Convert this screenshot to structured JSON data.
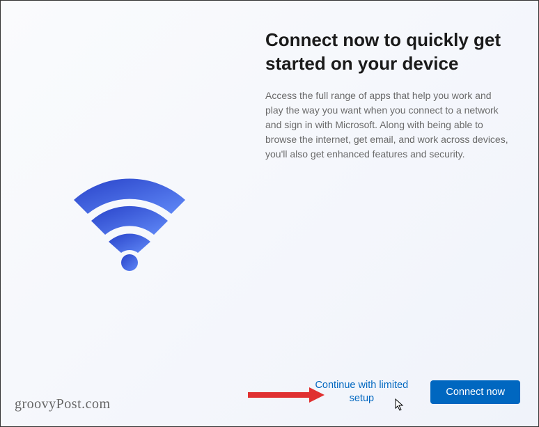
{
  "main": {
    "title": "Connect now to quickly get started on your device",
    "description": "Access the full range of apps that help you work and play the way you want when you connect to a network and sign in with Microsoft. Along with being able to browse the internet, get email, and work across devices, you'll also get enhanced features and security."
  },
  "actions": {
    "secondary_label": "Continue with limited setup",
    "primary_label": "Connect now"
  },
  "watermark": "groovyPost.com",
  "icons": {
    "wifi": "wifi-icon",
    "cursor": "cursor-icon",
    "arrow": "arrow-annotation"
  },
  "colors": {
    "accent": "#0067c0",
    "wifi_gradient_start": "#3b5bdb",
    "wifi_gradient_end": "#5c7cfa",
    "arrow": "#e03131"
  }
}
